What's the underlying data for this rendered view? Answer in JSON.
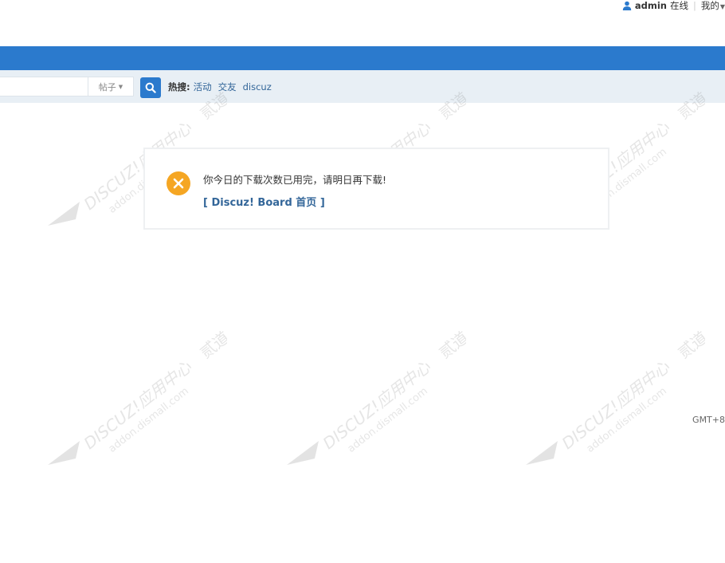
{
  "topbar": {
    "username": "admin",
    "status": "在线",
    "separator": "|",
    "my_menu": "我的"
  },
  "search": {
    "type_label": "帖子",
    "hot_label": "热搜:",
    "hot_terms": [
      "活动",
      "交友",
      "discuz"
    ]
  },
  "message": {
    "text": "你今日的下载次数已用完，请明日再下载!",
    "link": "[ Discuz! Board 首页 ]"
  },
  "footer": {
    "timezone": "GMT+8"
  },
  "watermark": {
    "brand": "DISCUZ!应用中心",
    "domain": "addon.dismall.com",
    "mark": "贰道"
  },
  "colors": {
    "nav": "#2b7acd",
    "search_strip": "#e8eff5",
    "error_icon": "#f5a623",
    "link": "#336699"
  }
}
